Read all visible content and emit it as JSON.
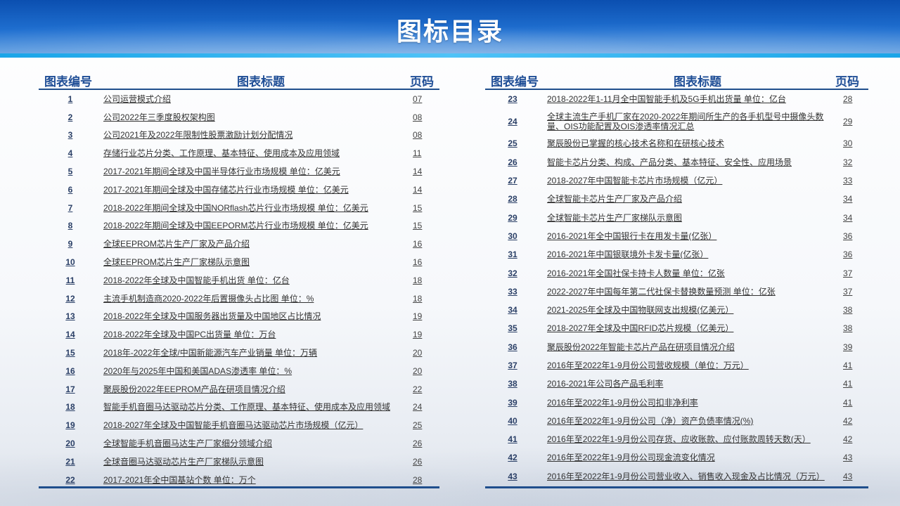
{
  "page_title": "图标目录",
  "headers": {
    "number": "图表编号",
    "title": "图表标题",
    "page": "页码"
  },
  "left_rows": [
    {
      "num": "1",
      "title": "公司运营模式介绍",
      "page": "07"
    },
    {
      "num": "2",
      "title": "公司2022年三季度股权架构图",
      "page": "08"
    },
    {
      "num": "3",
      "title": "公司2021年及2022年限制性股票激励计划分配情况",
      "page": "08"
    },
    {
      "num": "4",
      "title": "存储行业芯片分类、工作原理、基本特征、使用成本及应用领域",
      "page": "11"
    },
    {
      "num": "5",
      "title": "2017-2021年期间全球及中国半导体行业市场规模 单位：亿美元",
      "page": "14"
    },
    {
      "num": "6",
      "title": "2017-2021年期间全球及中国存储芯片行业市场规模 单位：亿美元",
      "page": "14"
    },
    {
      "num": "7",
      "title": "2018-2022年期间全球及中国NORflash芯片行业市场规模  单位：亿美元",
      "page": "15"
    },
    {
      "num": "8",
      "title": "2018-2022年期间全球及中国EEPORM芯片行业市场规模  单位：亿美元",
      "page": "15"
    },
    {
      "num": "9",
      "title": "全球EEPROM芯片生产厂家及产品介绍",
      "page": "16"
    },
    {
      "num": "10",
      "title": "全球EEPROM芯片生产厂家梯队示意图",
      "page": "16"
    },
    {
      "num": "11",
      "title": "2018-2022年全球及中国智能手机出货   单位：亿台",
      "page": "18"
    },
    {
      "num": "12",
      "title": "主流手机制造商2020-2022年后置摄像头占比图  单位：%",
      "page": "18"
    },
    {
      "num": "13",
      "title": "2018-2022年全球及中国服务器出货量及中国地区占比情况",
      "page": "19"
    },
    {
      "num": "14",
      "title": "2018-2022年全球及中国PC出货量  单位：万台",
      "page": "19"
    },
    {
      "num": "15",
      "title": "2018年-2022年全球/中国新能源汽车产业销量  单位：万辆",
      "page": "20"
    },
    {
      "num": "16",
      "title": "2020年与2025年中国和美国ADAS渗透率  单位：%",
      "page": "20"
    },
    {
      "num": "17",
      "title": "聚辰股份2022年EEPROM产品在研项目情况介绍",
      "page": "22"
    },
    {
      "num": "18",
      "title": "智能手机音圈马达驱动芯片分类、工作原理、基本特征、使用成本及应用领域",
      "page": "24"
    },
    {
      "num": "19",
      "title": "2018-2027年全球及中国智能手机音圈马达驱动芯片市场规模（亿元）",
      "page": "25"
    },
    {
      "num": "20",
      "title": "全球智能手机音圈马达生产厂家细分领域介绍",
      "page": "26"
    },
    {
      "num": "21",
      "title": "全球音圈马达驱动芯片生产厂家梯队示意图",
      "page": "26"
    },
    {
      "num": "22",
      "title": "2017-2021年全中国基站个数  单位：万个",
      "page": "28"
    }
  ],
  "right_rows": [
    {
      "num": "23",
      "title": "2018-2022年1-11月全中国智能手机及5G手机出货量  单位：亿台",
      "page": "28"
    },
    {
      "num": "24",
      "title": "全球主流生产手机厂家在2020-2022年期间所生产的各手机型号中摄像头数量、OIS功能配置及OIS渗透率情况汇总",
      "page": "29"
    },
    {
      "num": "25",
      "title": "聚辰股份已掌握的核心技术名称和在研核心技术",
      "page": "30"
    },
    {
      "num": "26",
      "title": "智能卡芯片分类、构成、产品分类、基本特征、安全性、应用场景",
      "page": "32"
    },
    {
      "num": "27",
      "title": "2018-2027年中国智能卡芯片市场规模（亿元）",
      "page": "33"
    },
    {
      "num": "28",
      "title": "全球智能卡芯片生产厂家及产品介绍",
      "page": "34"
    },
    {
      "num": "29",
      "title": "全球智能卡芯片生产厂家梯队示意图",
      "page": "34"
    },
    {
      "num": "30",
      "title": "2016-2021年全中国银行卡在用发卡量(亿张）",
      "page": "36"
    },
    {
      "num": "31",
      "title": "2016-2021年中国银联境外卡发卡量(亿张）",
      "page": "36"
    },
    {
      "num": "32",
      "title": "2016-2021年全国社保卡持卡人数量  单位：亿张",
      "page": "37"
    },
    {
      "num": "33",
      "title": "2022-2027年中国每年第二代社保卡替换数量预测  单位：亿张",
      "page": "37"
    },
    {
      "num": "34",
      "title": "2021-2025年全球及中国物联网支出规模(亿美元）",
      "page": "38"
    },
    {
      "num": "35",
      "title": "2018-2027年全球及中国RFID芯片规模（亿美元）",
      "page": "38"
    },
    {
      "num": "36",
      "title": "聚辰股份2022年智能卡芯片产品在研项目情况介绍",
      "page": "39"
    },
    {
      "num": "37",
      "title": "2016年至2022年1-9月份公司营收规模（单位：万元）",
      "page": "41"
    },
    {
      "num": "38",
      "title": "2016-2021年公司各产品毛利率",
      "page": "41"
    },
    {
      "num": "39",
      "title": "2016年至2022年1-9月份公司扣非净利率",
      "page": "41"
    },
    {
      "num": "40",
      "title": "2016年至2022年1-9月份公司（净）资产负债率情况(%)",
      "page": "42"
    },
    {
      "num": "41",
      "title": "2016年至2022年1-9月份公司存货、应收账款、应付账款周转天数(天）",
      "page": "42"
    },
    {
      "num": "42",
      "title": "2016年至2022年1-9月份公司现金流变化情况",
      "page": "43"
    },
    {
      "num": "43",
      "title": "2016年至2022年1-9月份公司营业收入、销售收入现金及占比情况（万元）",
      "page": "43"
    }
  ]
}
